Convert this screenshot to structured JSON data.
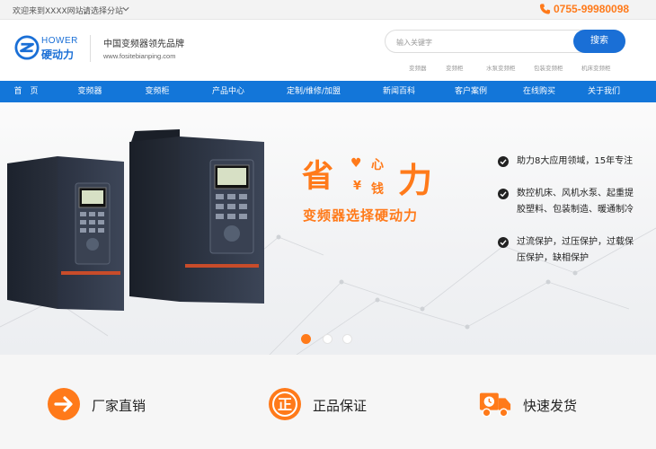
{
  "topbar": {
    "welcome": "欢迎来到XXXX网站，",
    "branch": "请选择分站",
    "phone": "0755-99980098"
  },
  "header": {
    "logo_en": "HOWER",
    "logo_cn": "硬动力",
    "slogan": "中国变频器领先品牌",
    "domain": "www.fositebianping.com",
    "search_placeholder": "输入关键字",
    "search_button": "搜索",
    "hot_words": [
      "变频器",
      "变频柜",
      "水泵变频柜",
      "包装变频柜",
      "机床变频柜"
    ]
  },
  "nav": {
    "items": [
      "首　页",
      "变频器",
      "变频柜",
      "产品中心",
      "定制/维修/加盟",
      "新闻百科",
      "客户案例",
      "在线购买",
      "关于我们"
    ]
  },
  "banner": {
    "headline_left": "省",
    "heart": "♥",
    "xin": "心",
    "yen": "¥",
    "qian": "钱",
    "headline_right": "力",
    "subtitle": "变频器选择硬动力",
    "features": [
      [
        "助力8大应用领域，15年专注"
      ],
      [
        "数控机床、风机水泵、起重提",
        "胶塑料、包装制造、暖通制冷"
      ],
      [
        "过流保护，过压保护，过载保",
        "压保护，缺相保护"
      ]
    ],
    "slides": 3,
    "active_slide": 1,
    "accent_color": "#ff7a1a"
  },
  "features_bar": [
    {
      "icon": "arrow-right-circle-icon",
      "label": "厂家直销"
    },
    {
      "icon": "genuine-stamp-icon",
      "label": "正品保证"
    },
    {
      "icon": "delivery-truck-icon",
      "label": "快速发货"
    }
  ],
  "colors": {
    "brand_blue": "#1376d9",
    "accent_orange": "#ff7a1a"
  }
}
